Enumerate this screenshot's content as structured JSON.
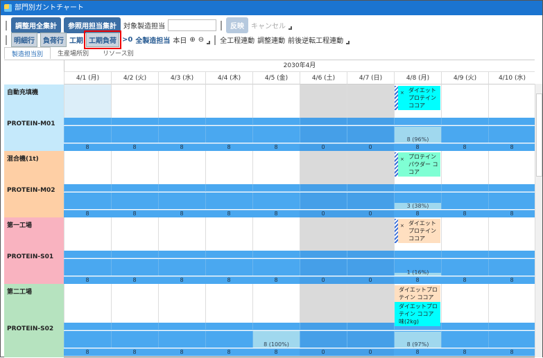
{
  "window": {
    "title": "部門別ガントチャート"
  },
  "toolbar1": {
    "adjust_total": "調整用全集計",
    "ref_total": "参照用担当集計",
    "target_label": "対象製造担当",
    "target_value": "",
    "apply": "反映",
    "cancel": "キャンセル"
  },
  "toolbar2": {
    "detail_row": "明細行",
    "load_row": "負荷行",
    "period": "工期",
    "period_load": "工期負荷",
    "gt0": ">0",
    "all_mfg": "全製造担当",
    "today": "本日",
    "link_all": "全工程連動",
    "link_adjust": "調整連動",
    "link_reverse": "前後逆転工程連動"
  },
  "tabs": [
    "製造担当別",
    "生産場所別",
    "リソース別"
  ],
  "month": "2030年4月",
  "days": [
    "4/1 (月)",
    "4/2 (火)",
    "4/3 (水)",
    "4/4 (木)",
    "4/5 (金)",
    "4/6 (土)",
    "4/7 (日)",
    "4/8 (月)",
    "4/9 (火)",
    "4/10 (水)"
  ],
  "weekend_idx": [
    5,
    6
  ],
  "colors": {
    "band": "#4aa8f0",
    "band_weekend": "#459fe8",
    "weekend": "#dadada",
    "load": "#a0d8ee"
  },
  "groups": [
    {
      "name": "自動充填機",
      "code": "PROTEIN-M01",
      "color": "#c5e9fb",
      "today_hl": true,
      "values": [
        8,
        8,
        8,
        8,
        8,
        0,
        0,
        8,
        8,
        8
      ],
      "loads": [
        {
          "day": 7,
          "label": "8 (96%)",
          "pct": 96
        }
      ],
      "cards": [
        {
          "day": 7,
          "text": "ダイエットプロテイン ココア",
          "color": "#00ffff",
          "stripe": true
        }
      ]
    },
    {
      "name": "混合機(1t)",
      "code": "PROTEIN-M02",
      "color": "#fecfa5",
      "values": [
        8,
        8,
        8,
        8,
        8,
        0,
        0,
        8,
        8,
        8
      ],
      "loads": [
        {
          "day": 7,
          "label": "3 (38%)",
          "pct": 38
        }
      ],
      "cards": [
        {
          "day": 7,
          "text": "プロテインパウダー ココア",
          "color": "#7fffd4",
          "stripe": true
        }
      ]
    },
    {
      "name": "第一工場",
      "code": "PROTEIN-S01",
      "color": "#f9b3c0",
      "values": [
        8,
        8,
        8,
        8,
        8,
        0,
        0,
        8,
        8,
        8
      ],
      "loads": [
        {
          "day": 7,
          "label": "1 (16%)",
          "pct": 16
        }
      ],
      "cards": [
        {
          "day": 7,
          "text": "ダイエットプロテイン ココア",
          "color": "#ffdfc0",
          "stripe": true
        }
      ]
    },
    {
      "name": "第二工場",
      "code": "PROTEIN-S02",
      "color": "#b6e3bf",
      "tall": true,
      "values": [
        8,
        8,
        8,
        8,
        8,
        0,
        0,
        8,
        8,
        8
      ],
      "loads": [
        {
          "day": 4,
          "label": "8 (100%)",
          "pct": 100
        },
        {
          "day": 7,
          "label": "8 (97%)",
          "pct": 97
        }
      ],
      "cards": [
        {
          "day": 7,
          "text": "ダイエットプロテイン ココア味(2kg)",
          "color": "#ffdfc0",
          "stripe": false
        },
        {
          "day": 7,
          "text": "ダイエットプロテイン ココア味(2kg)",
          "color": "#00ffff",
          "stripe": false,
          "second": true
        }
      ]
    }
  ]
}
